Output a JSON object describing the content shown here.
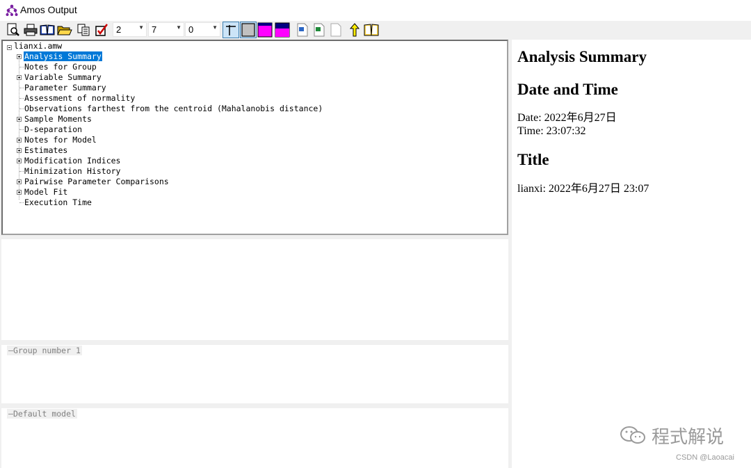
{
  "window": {
    "title": "Amos Output"
  },
  "toolbar": {
    "combos": [
      {
        "value": "2"
      },
      {
        "value": "7"
      },
      {
        "value": "0"
      }
    ]
  },
  "tree": {
    "root": "lianxi.amw",
    "items": [
      {
        "label": "Analysis Summary",
        "expandable": true,
        "selected": true
      },
      {
        "label": "Notes for Group",
        "expandable": false
      },
      {
        "label": "Variable Summary",
        "expandable": true
      },
      {
        "label": "Parameter Summary",
        "expandable": false
      },
      {
        "label": "Assessment of normality",
        "expandable": false
      },
      {
        "label": "Observations farthest from the centroid (Mahalanobis distance)",
        "expandable": false
      },
      {
        "label": "Sample Moments",
        "expandable": true
      },
      {
        "label": "D-separation",
        "expandable": false
      },
      {
        "label": "Notes for Model",
        "expandable": true
      },
      {
        "label": "Estimates",
        "expandable": true
      },
      {
        "label": "Modification Indices",
        "expandable": true
      },
      {
        "label": "Minimization History",
        "expandable": false
      },
      {
        "label": "Pairwise Parameter Comparisons",
        "expandable": true
      },
      {
        "label": "Model Fit",
        "expandable": true
      },
      {
        "label": "Execution Time",
        "expandable": false
      }
    ]
  },
  "groups_panel": {
    "label": "Group number 1"
  },
  "models_panel": {
    "label": "Default model"
  },
  "output": {
    "heading": "Analysis Summary",
    "date_heading": "Date and Time",
    "date_line": "Date: 2022年6月27日",
    "time_line": "Time: 23:07:32",
    "title_heading": "Title",
    "title_line": "lianxi: 2022年6月27日  23:07"
  },
  "watermark": {
    "text": "程式解说",
    "credit": "CSDN @Laoacai"
  },
  "colors": {
    "selection": "#0078d7",
    "magenta": "#ff00ff",
    "navy": "#000080"
  }
}
